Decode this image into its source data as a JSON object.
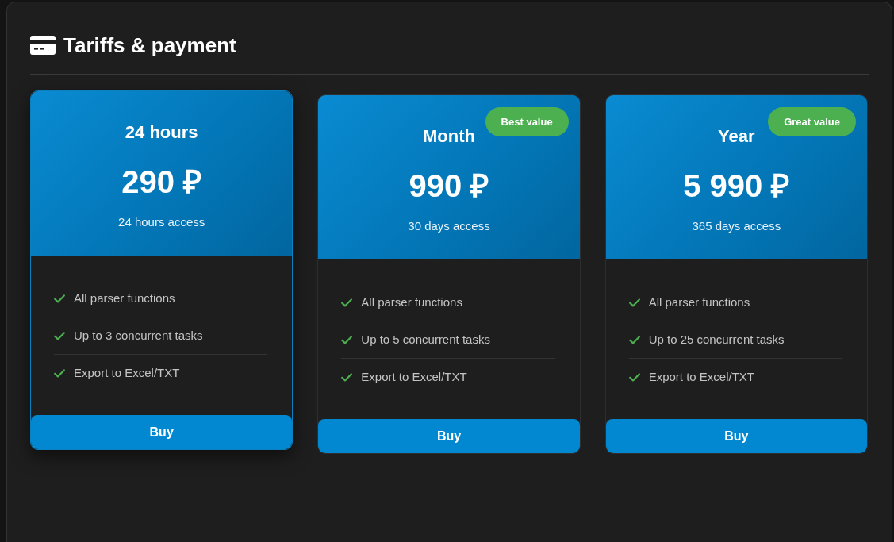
{
  "panel": {
    "title": "Tariffs & payment"
  },
  "plans": [
    {
      "name": "24 hours",
      "price": "290 ₽",
      "period": "24 hours access",
      "highlighted": true,
      "features": [
        "All parser functions",
        "Up to 3 concurrent tasks",
        "Export to Excel/TXT"
      ],
      "button": "Buy"
    },
    {
      "name": "Month",
      "price": "990 ₽",
      "period": "30 days access",
      "badge": "Best value",
      "highlighted": false,
      "features": [
        "All parser functions",
        "Up to 5 concurrent tasks",
        "Export to Excel/TXT"
      ],
      "button": "Buy"
    },
    {
      "name": "Year",
      "price": "5 990 ₽",
      "period": "365 days access",
      "badge": "Great value",
      "highlighted": false,
      "features": [
        "All parser functions",
        "Up to 25 concurrent tasks",
        "Export to Excel/TXT"
      ],
      "button": "Buy"
    }
  ]
}
